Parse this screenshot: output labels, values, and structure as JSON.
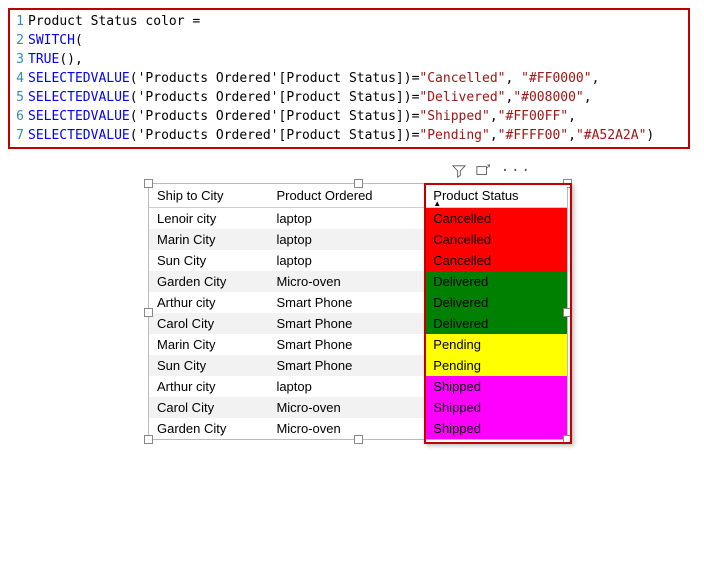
{
  "code": {
    "lines": [
      "Product Status color =",
      "SWITCH(",
      "TRUE(),",
      "SELECTEDVALUE('Products Ordered'[Product Status])=\"Cancelled\", \"#FF0000\",",
      "SELECTEDVALUE('Products Ordered'[Product Status])=\"Delivered\",\"#008000\",",
      "SELECTEDVALUE('Products Ordered'[Product Status])=\"Shipped\",\"#FF00FF\",",
      "SELECTEDVALUE('Products Ordered'[Product Status])=\"Pending\",\"#FFFF00\",\"#A52A2A\")"
    ]
  },
  "toolbar": {
    "filter": "filter-icon",
    "focus": "focus-mode-icon",
    "more": "···"
  },
  "table": {
    "headers": {
      "city": "Ship to City",
      "product": "Product Ordered",
      "status": "Product Status"
    },
    "rows": [
      {
        "city": "Lenoir city",
        "product": "laptop",
        "status": "Cancelled",
        "bg": "#FF0000"
      },
      {
        "city": "Marin City",
        "product": "laptop",
        "status": "Cancelled",
        "bg": "#FF0000"
      },
      {
        "city": "Sun City",
        "product": "laptop",
        "status": "Cancelled",
        "bg": "#FF0000"
      },
      {
        "city": "Garden City",
        "product": "Micro-oven",
        "status": "Delivered",
        "bg": "#008000"
      },
      {
        "city": "Arthur city",
        "product": "Smart Phone",
        "status": "Delivered",
        "bg": "#008000"
      },
      {
        "city": "Carol City",
        "product": "Smart Phone",
        "status": "Delivered",
        "bg": "#008000"
      },
      {
        "city": "Marin City",
        "product": "Smart Phone",
        "status": "Pending",
        "bg": "#FFFF00"
      },
      {
        "city": "Sun City",
        "product": "Smart Phone",
        "status": "Pending",
        "bg": "#FFFF00"
      },
      {
        "city": "Arthur city",
        "product": "laptop",
        "status": "Shipped",
        "bg": "#FF00FF"
      },
      {
        "city": "Carol City",
        "product": "Micro-oven",
        "status": "Shipped",
        "bg": "#FF00FF"
      },
      {
        "city": "Garden City",
        "product": "Micro-oven",
        "status": "Shipped",
        "bg": "#FF00FF"
      }
    ]
  },
  "status_colors": {
    "Cancelled": "#FF0000",
    "Delivered": "#008000",
    "Shipped": "#FF00FF",
    "Pending": "#FFFF00",
    "default": "#A52A2A"
  }
}
